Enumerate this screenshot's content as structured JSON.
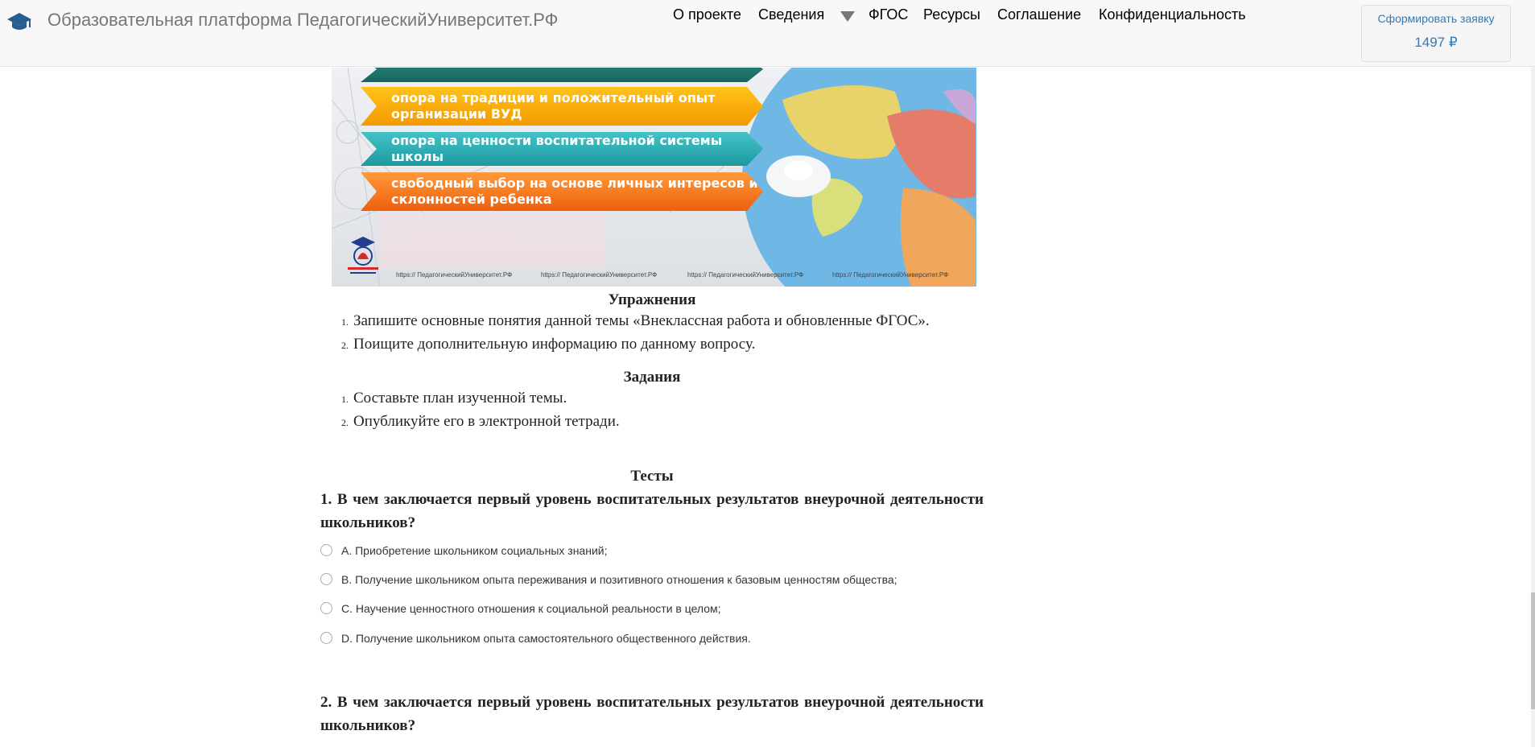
{
  "header": {
    "brand": "Образовательная платформа ПедагогическийУниверситет.РФ",
    "nav": [
      "О проекте",
      "Сведения",
      "ФГОС",
      "Ресурсы",
      "Соглашение",
      "Конфиденциальность"
    ],
    "order_label": "Сформировать заявку",
    "order_price": "1497 ₽"
  },
  "banner": {
    "arrows": [
      "",
      "опора на традиции и положительный опыт организации ВУД",
      "опора на ценности воспитательной системы школы",
      "свободный выбор на основе личных интересов и склонностей ребенка"
    ],
    "logo_text": "Педагогический Университет.РФ",
    "watermark": "https:// ПедагогическийУниверситет.РФ"
  },
  "exercises": {
    "title": "Упражнения",
    "items": [
      "Запишите основные понятия данной темы «Внеклассная работа и обновленные ФГОС».",
      "Поищите дополнительную информацию по данному вопросу."
    ]
  },
  "tasks": {
    "title": "Задания",
    "items": [
      "Составьте план изученной темы.",
      "Опубликуйте его в электронной тетради."
    ]
  },
  "tests": {
    "title": "Тесты",
    "questions": [
      {
        "text": "1. В чем заключается первый уровень воспитательных результатов внеурочной деятельности школьников?",
        "answers": [
          "A. Приобретение школьником социальных знаний;",
          "B. Получение школьником опыта переживания и позитивного отношения к базовым ценностям общества;",
          "C. Научение ценностного отношения к социальной реальности в целом;",
          "D. Получение школьником опыта самостоятельного общественного действия."
        ]
      },
      {
        "text": "2. В чем заключается первый уровень воспитательных результатов внеурочной деятельности школьников?",
        "answers": []
      }
    ]
  },
  "colors": {
    "link": "#337ab7",
    "nav_text": "#000000",
    "brand_text": "#777777"
  }
}
